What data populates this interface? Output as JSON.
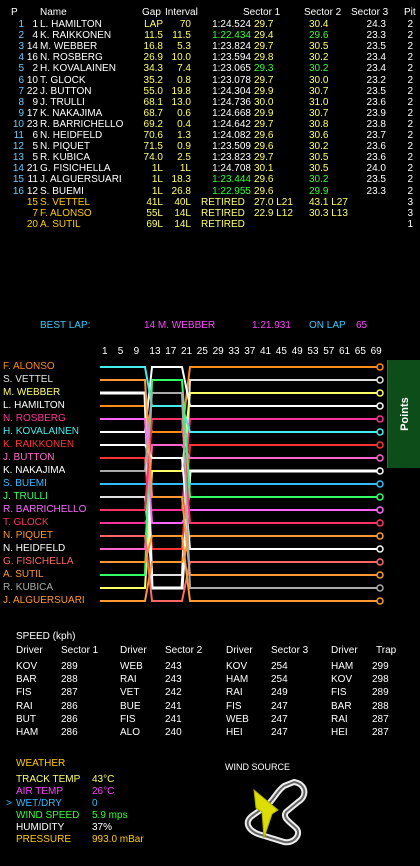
{
  "table": {
    "headers": {
      "p": "P",
      "name": "Name",
      "gap": "Gap",
      "interval": "Interval",
      "time": "",
      "s1": "Sector 1",
      "s2": "Sector 2",
      "s3": "Sector 3",
      "pit": "Pit"
    },
    "rows": [
      {
        "p": "1",
        "num": "1",
        "name": "L. HAMILTON",
        "gap": "LAP",
        "interval": "70",
        "time": "1:24.524",
        "s1": "29.7",
        "s2": "30.4",
        "s3": "24.3",
        "pit": "2",
        "c_gap": "#ffff66",
        "c_s2": "#ffff66",
        "c_s1": "#ffff66"
      },
      {
        "p": "2",
        "num": "4",
        "name": "K. RAIKKONEN",
        "gap": "11.5",
        "interval": "11.5",
        "time": "1:22.434",
        "s1": "29.4",
        "s2": "29.6",
        "s3": "23.3",
        "pit": "2",
        "c_time": "#33ff33",
        "c_s2": "#33ff33"
      },
      {
        "p": "3",
        "num": "14",
        "name": "M. WEBBER",
        "gap": "16.8",
        "interval": "5.3",
        "time": "1:23.824",
        "s1": "29.7",
        "s2": "30.5",
        "s3": "23.5",
        "pit": "2"
      },
      {
        "p": "4",
        "num": "16",
        "name": "N. ROSBERG",
        "gap": "26.9",
        "interval": "10.0",
        "time": "1:23.594",
        "s1": "29.8",
        "s2": "30.2",
        "s3": "23.4",
        "pit": "2"
      },
      {
        "p": "5",
        "num": "2",
        "name": "H. KOVALAINEN",
        "gap": "34.3",
        "interval": "7.4",
        "time": "1:23.065",
        "s1": "29.3",
        "s2": "30.2",
        "s3": "23.4",
        "pit": "2",
        "c_s1": "#33ff33",
        "c_s2": "#33ff33"
      },
      {
        "p": "6",
        "num": "10",
        "name": "T. GLOCK",
        "gap": "35.2",
        "interval": "0.8",
        "time": "1:23.078",
        "s1": "29.7",
        "s2": "30.0",
        "s3": "23.2",
        "pit": "2"
      },
      {
        "p": "7",
        "num": "22",
        "name": "J. BUTTON",
        "gap": "55.0",
        "interval": "19.8",
        "time": "1:24.304",
        "s1": "29.9",
        "s2": "30.7",
        "s3": "23.5",
        "pit": "2"
      },
      {
        "p": "8",
        "num": "9",
        "name": "J. TRULLI",
        "gap": "68.1",
        "interval": "13.0",
        "time": "1:24.736",
        "s1": "30.0",
        "s2": "31.0",
        "s3": "23.6",
        "pit": "2"
      },
      {
        "p": "9",
        "num": "17",
        "name": "K. NAKAJIMA",
        "gap": "68.7",
        "interval": "0.6",
        "time": "1:24.668",
        "s1": "29.9",
        "s2": "30.7",
        "s3": "23.9",
        "pit": "2"
      },
      {
        "p": "10",
        "num": "23",
        "name": "R. BARRICHELLO",
        "gap": "69.2",
        "interval": "0.4",
        "time": "1:24.642",
        "s1": "29.7",
        "s2": "30.8",
        "s3": "23.8",
        "pit": "2"
      },
      {
        "p": "11",
        "num": "6",
        "name": "N. HEIDFELD",
        "gap": "70.6",
        "interval": "1.3",
        "time": "1:24.082",
        "s1": "29.6",
        "s2": "30.6",
        "s3": "23.7",
        "pit": "2"
      },
      {
        "p": "12",
        "num": "5",
        "name": "N. PIQUET",
        "gap": "71.5",
        "interval": "0.9",
        "time": "1:23.509",
        "s1": "29.6",
        "s2": "30.2",
        "s3": "23.6",
        "pit": "2"
      },
      {
        "p": "13",
        "num": "5",
        "name": "R. KUBICA",
        "gap": "74.0",
        "interval": "2.5",
        "time": "1:23.823",
        "s1": "29.7",
        "s2": "30.5",
        "s3": "23.6",
        "pit": "2"
      },
      {
        "p": "14",
        "num": "21",
        "name": "G. FISICHELLA",
        "gap": "1L",
        "interval": "1L",
        "time": "1:24.708",
        "s1": "30.1",
        "s2": "30.5",
        "s3": "24.0",
        "pit": "2"
      },
      {
        "p": "15",
        "num": "11",
        "name": "J. ALGUERSUARI",
        "gap": "1L",
        "interval": "18.3",
        "time": "1:23.444",
        "s1": "29.6",
        "s2": "30.2",
        "s3": "23.5",
        "pit": "2",
        "c_time": "#33ff33",
        "c_s2": "#33ff33"
      },
      {
        "p": "16",
        "num": "12",
        "name": "S. BUEMI",
        "gap": "1L",
        "interval": "26.8",
        "time": "1:22.955",
        "s1": "29.6",
        "s2": "29.9",
        "s3": "23.3",
        "pit": "2",
        "c_time": "#33ff33",
        "c_s2": "#33ff33"
      },
      {
        "p": "",
        "num": "15",
        "name": "S. VETTEL",
        "gap": "41L",
        "interval": "40L",
        "time": "RETIRED",
        "s1": "27.0 L21",
        "s2": "43.1 L27",
        "s3": "",
        "pit": "3",
        "retired": true
      },
      {
        "p": "",
        "num": "7",
        "name": "F. ALONSO",
        "gap": "55L",
        "interval": "14L",
        "time": "RETIRED",
        "s1": "22.9 L12",
        "s2": "30.3 L13",
        "s3": "",
        "pit": "3",
        "retired": true
      },
      {
        "p": "",
        "num": "20",
        "name": "A. SUTIL",
        "gap": "69L",
        "interval": "14L",
        "time": "RETIRED",
        "s1": "",
        "s2": "",
        "s3": "",
        "pit": "1",
        "retired": true
      }
    ]
  },
  "best_lap": {
    "label": "BEST LAP:",
    "driver": "14 M. WEBBER",
    "time": "1:21.931",
    "on_lap_label": "ON LAP",
    "lap": "65"
  },
  "chart": {
    "lap_ticks": [
      "1",
      "5",
      "9",
      "13",
      "17",
      "21",
      "25",
      "29",
      "33",
      "37",
      "41",
      "45",
      "49",
      "53",
      "57",
      "61",
      "65",
      "69"
    ],
    "drivers": [
      {
        "name": "F. ALONSO",
        "color": "#ff8c1a"
      },
      {
        "name": "S. VETTEL",
        "color": "#e0e0e0"
      },
      {
        "name": "M. WEBBER",
        "color": "#ffff66"
      },
      {
        "name": "L. HAMILTON",
        "color": "#ffffff"
      },
      {
        "name": "N. ROSBERG",
        "color": "#ff3399"
      },
      {
        "name": "H. KOVALAINEN",
        "color": "#44eeee"
      },
      {
        "name": "K. RAIKKONEN",
        "color": "#ff3333"
      },
      {
        "name": "J. BUTTON",
        "color": "#ff66cc"
      },
      {
        "name": "K. NAKAJIMA",
        "color": "#ffffff"
      },
      {
        "name": "S. BUEMI",
        "color": "#33bbff"
      },
      {
        "name": "J. TRULLI",
        "color": "#33ff66"
      },
      {
        "name": "R. BARRICHELLO",
        "color": "#ff66ff"
      },
      {
        "name": "T. GLOCK",
        "color": "#ff3366"
      },
      {
        "name": "N. PIQUET",
        "color": "#ff9933"
      },
      {
        "name": "N. HEIDFELD",
        "color": "#ffffff"
      },
      {
        "name": "G. FISICHELLA",
        "color": "#ff6666"
      },
      {
        "name": "A. SUTIL",
        "color": "#ff9933"
      },
      {
        "name": "R. KUBICA",
        "color": "#aaaaaa"
      },
      {
        "name": "J. ALGUERSUARI",
        "color": "#ff9933"
      }
    ],
    "points_tab": "Points"
  },
  "speed": {
    "title": "SPEED (kph)",
    "blocks": [
      {
        "col1": "Driver",
        "col2": "Sector 1",
        "rows": [
          [
            "KOV",
            "289"
          ],
          [
            "BAR",
            "288"
          ],
          [
            "FIS",
            "287"
          ],
          [
            "RAI",
            "286"
          ],
          [
            "BUT",
            "286"
          ],
          [
            "HAM",
            "286"
          ]
        ]
      },
      {
        "col1": "Driver",
        "col2": "Sector 2",
        "rows": [
          [
            "WEB",
            "243"
          ],
          [
            "RAI",
            "243"
          ],
          [
            "VET",
            "242"
          ],
          [
            "BUE",
            "241"
          ],
          [
            "FIS",
            "241"
          ],
          [
            "ALO",
            "240"
          ]
        ]
      },
      {
        "col1": "Driver",
        "col2": "Sector 3",
        "rows": [
          [
            "KOV",
            "254"
          ],
          [
            "HAM",
            "254"
          ],
          [
            "RAI",
            "249"
          ],
          [
            "FIS",
            "247"
          ],
          [
            "WEB",
            "247"
          ],
          [
            "HEI",
            "247"
          ]
        ]
      },
      {
        "col1": "Driver",
        "col2": "Trap",
        "rows": [
          [
            "HAM",
            "299"
          ],
          [
            "KOV",
            "298"
          ],
          [
            "FIS",
            "289"
          ],
          [
            "BAR",
            "288"
          ],
          [
            "RAI",
            "287"
          ],
          [
            "HEI",
            "287"
          ]
        ]
      }
    ]
  },
  "weather": {
    "title": "WEATHER",
    "items": [
      {
        "label": "TRACK TEMP",
        "value": "43°C",
        "color": "#ffff66"
      },
      {
        "label": "AIR TEMP",
        "value": "26°C",
        "color": "#ff44ff"
      },
      {
        "label": "WET/DRY",
        "value": "0",
        "color": "#33bbff",
        "selected": true
      },
      {
        "label": "WIND SPEED",
        "value": "5.9 mps",
        "color": "#33ff33"
      },
      {
        "label": "HUMIDITY",
        "value": "37%",
        "color": "#ffffff"
      },
      {
        "label": "PRESSURE",
        "value": "993.0 mBar",
        "color": "#ffcc00"
      }
    ],
    "selector": ">",
    "wind_source": "WIND SOURCE"
  }
}
